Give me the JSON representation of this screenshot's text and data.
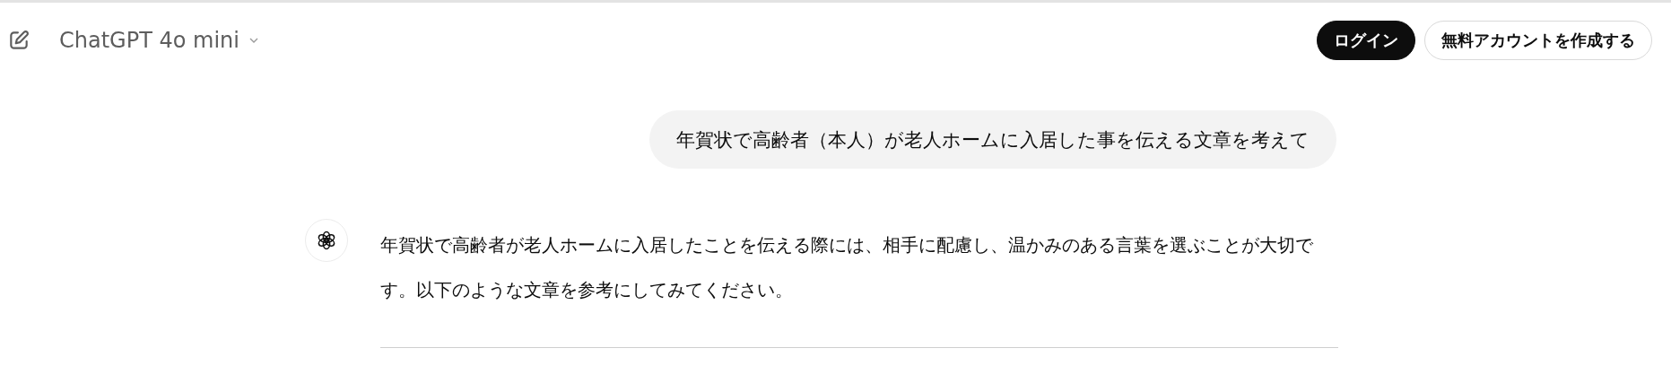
{
  "header": {
    "model_title": "ChatGPT 4o mini",
    "buttons": [
      {
        "kind": "primary",
        "label": "ログイン"
      },
      {
        "kind": "secondary",
        "label": "無料アカウントを作成する"
      }
    ]
  },
  "messages": [
    {
      "kind": "user",
      "text": "年賀状で高齢者（本人）が老人ホームに入居した事を伝える文章を考えて"
    },
    {
      "kind": "assistant",
      "text": "年賀状で高齢者が老人ホームに入居したことを伝える際には、相手に配慮し、温かみのある言葉を選ぶことが大切です。以下のような文章を参考にしてみてください。"
    }
  ]
}
